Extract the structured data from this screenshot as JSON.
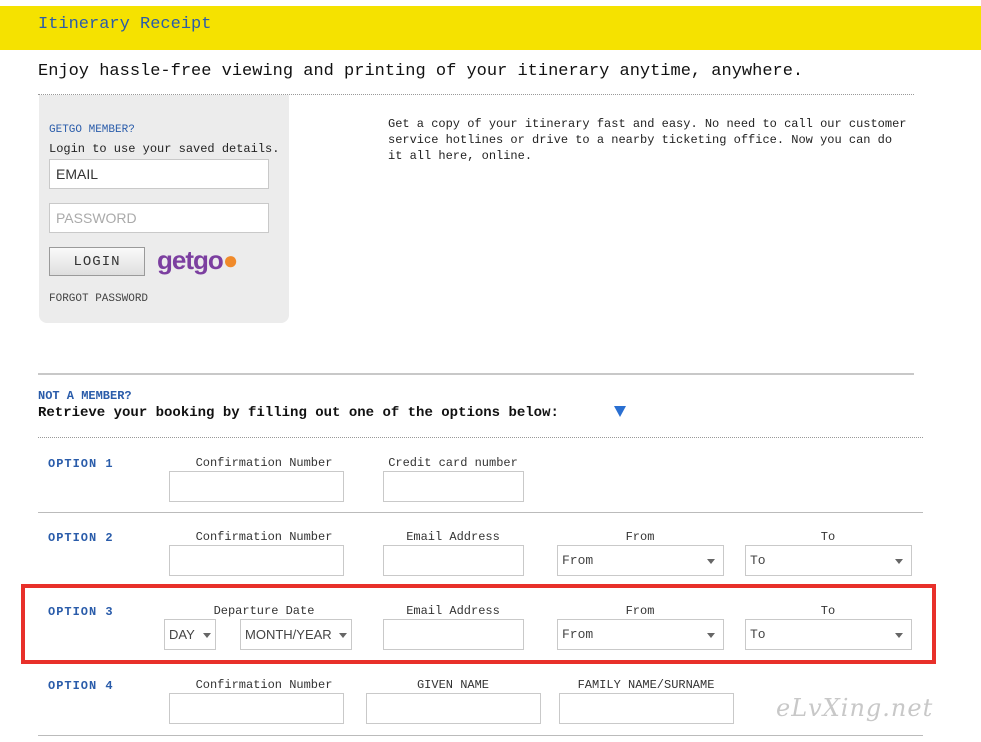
{
  "header": {
    "title": "Itinerary Receipt"
  },
  "tagline": "Enjoy hassle-free viewing and printing of your itinerary anytime, anywhere.",
  "login": {
    "member_prompt": "GETGO MEMBER?",
    "hint": "Login to use your saved details.",
    "email_placeholder": "EMAIL",
    "password_placeholder": "PASSWORD",
    "login_label": "LOGIN",
    "logo_part1": "getgo",
    "forgot_label": "FORGOT PASSWORD"
  },
  "info": "Get a copy of your itinerary fast and easy. No need to call our customer service hotlines or drive to a nearby ticketing office. Now you can do it all here, online.",
  "retrieve": {
    "not_member": "NOT A MEMBER?",
    "instruction": "Retrieve your booking by filling out one of the options below:"
  },
  "options": {
    "o1": {
      "label": "OPTION 1",
      "f1": "Confirmation Number",
      "f2": "Credit card number"
    },
    "o2": {
      "label": "OPTION 2",
      "f1": "Confirmation Number",
      "f2": "Email Address",
      "f3": "From",
      "f4": "To",
      "from_value": "From",
      "to_value": "To"
    },
    "o3": {
      "label": "OPTION 3",
      "f1": "Departure Date",
      "f2": "Email Address",
      "f3": "From",
      "f4": "To",
      "day_value": "DAY",
      "month_value": "MONTH/YEAR",
      "from_value": "From",
      "to_value": "To"
    },
    "o4": {
      "label": "OPTION 4",
      "f1": "Confirmation Number",
      "f2": "GIVEN NAME",
      "f3": "FAMILY NAME/SURNAME"
    }
  },
  "watermark": "eLvXing.net",
  "colors": {
    "header_bar": "#f5e200",
    "accent_blue": "#2a5caa",
    "highlight_red": "#e8302a"
  }
}
